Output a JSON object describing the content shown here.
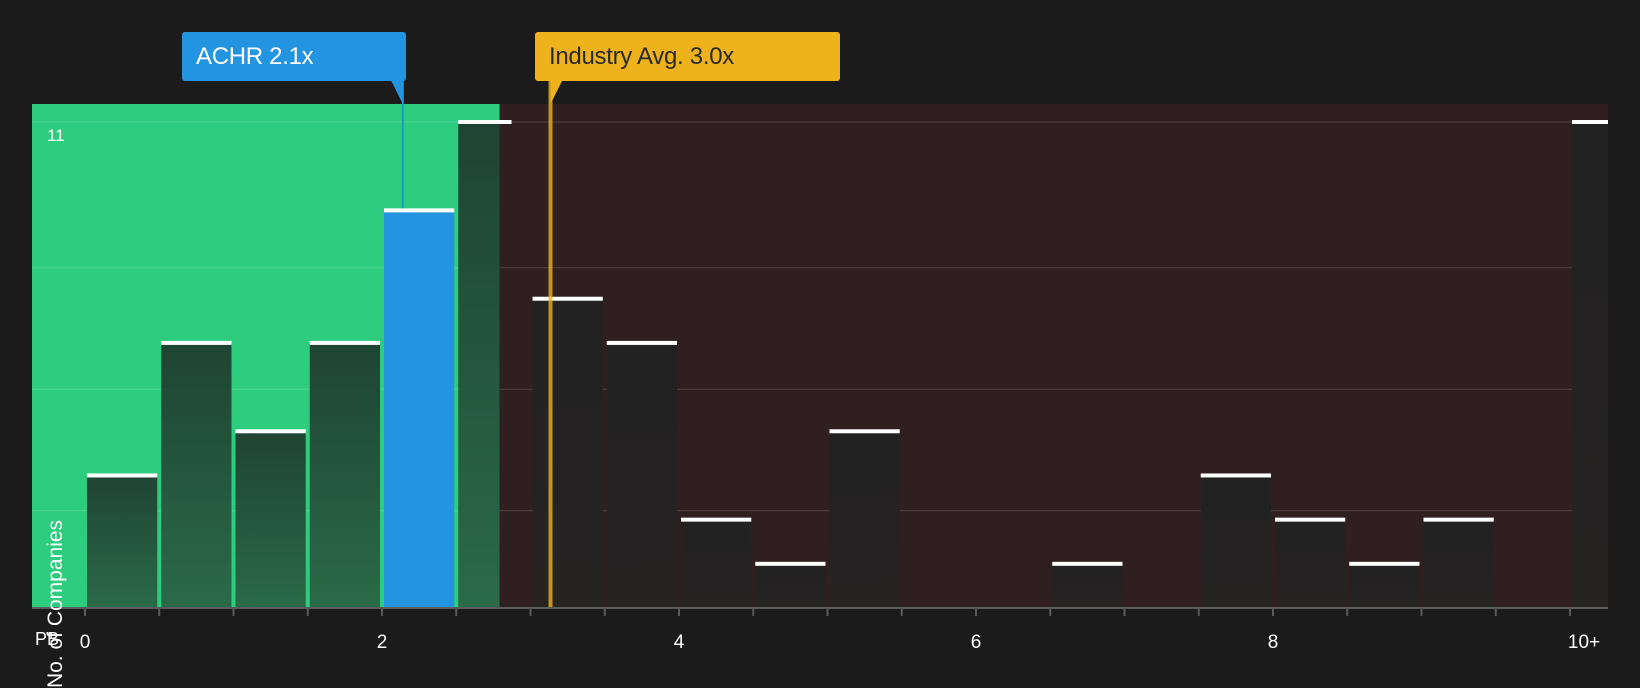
{
  "callouts": {
    "company": "ACHR 2.1x",
    "industry": "Industry Avg. 3.0x"
  },
  "y_axis_label": "No. of Companies",
  "y_max_label": "11",
  "x_axis_prefix": "PB",
  "colors": {
    "background": "#1b1b1c",
    "below_industry_region": "#2ecc7e",
    "above_industry_region": "#2f1f20",
    "company_bar": "#2394e0",
    "industry_marker": "#eeb21d",
    "bar_cap": "#ffffff"
  },
  "chart_data": {
    "type": "bar",
    "xlabel": "PB",
    "ylabel": "No. of Companies",
    "xlim": [
      0,
      10.5
    ],
    "ylim": [
      0,
      11
    ],
    "x_ticks": [
      "0",
      "2",
      "4",
      "6",
      "8",
      "10+"
    ],
    "y_max_tick": "11",
    "bin_width": 0.5,
    "bins": [
      {
        "x0": 0.0,
        "x1": 0.5,
        "count": 3
      },
      {
        "x0": 0.5,
        "x1": 1.0,
        "count": 6
      },
      {
        "x0": 1.0,
        "x1": 1.5,
        "count": 4
      },
      {
        "x0": 1.5,
        "x1": 2.0,
        "count": 6
      },
      {
        "x0": 2.0,
        "x1": 2.5,
        "count": 9,
        "highlight": true
      },
      {
        "x0": 2.5,
        "x1": 3.0,
        "count": 11
      },
      {
        "x0": 3.0,
        "x1": 3.5,
        "count": 7
      },
      {
        "x0": 3.5,
        "x1": 4.0,
        "count": 6
      },
      {
        "x0": 4.0,
        "x1": 4.5,
        "count": 2
      },
      {
        "x0": 4.5,
        "x1": 5.0,
        "count": 1
      },
      {
        "x0": 5.0,
        "x1": 5.5,
        "count": 4
      },
      {
        "x0": 5.5,
        "x1": 6.0,
        "count": 0
      },
      {
        "x0": 6.0,
        "x1": 6.5,
        "count": 0
      },
      {
        "x0": 6.5,
        "x1": 7.0,
        "count": 1
      },
      {
        "x0": 7.0,
        "x1": 7.5,
        "count": 0
      },
      {
        "x0": 7.5,
        "x1": 8.0,
        "count": 3
      },
      {
        "x0": 8.0,
        "x1": 8.5,
        "count": 2
      },
      {
        "x0": 8.5,
        "x1": 9.0,
        "count": 1
      },
      {
        "x0": 9.0,
        "x1": 9.5,
        "count": 2
      },
      {
        "x0": 9.5,
        "x1": 10.0,
        "count": 0
      },
      {
        "x0": 10.0,
        "x1": 10.5,
        "count": 11
      }
    ],
    "company_value": 2.1,
    "industry_avg": 3.0
  }
}
